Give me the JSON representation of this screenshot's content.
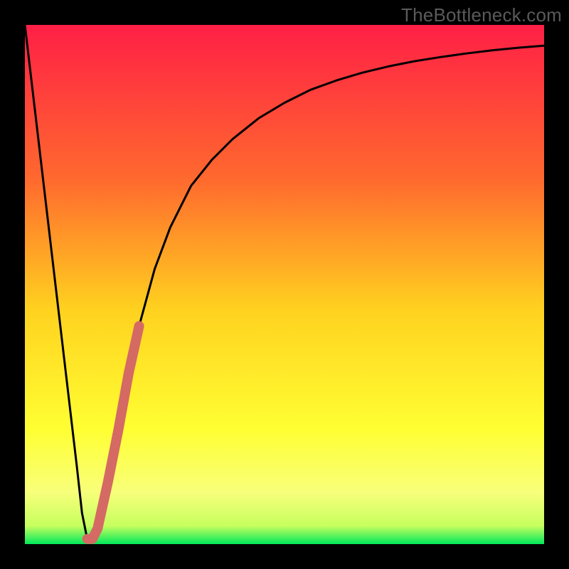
{
  "watermark": "TheBottleneck.com",
  "colors": {
    "frame": "#000000",
    "gradient_top": "#ff1f46",
    "gradient_mid1": "#ff6a2e",
    "gradient_mid2": "#ffd21f",
    "gradient_mid3": "#ffff33",
    "gradient_bottom_band": "#f8ff7a",
    "gradient_bottom": "#00e85c",
    "curve_stroke": "#000000",
    "accent_stroke": "#d46a63"
  },
  "chart_data": {
    "type": "line",
    "title": "",
    "xlabel": "",
    "ylabel": "",
    "xlim": [
      0,
      100
    ],
    "ylim": [
      0,
      100
    ],
    "series": [
      {
        "name": "bottleneck-curve",
        "x": [
          0,
          2,
          4,
          6,
          8,
          10,
          11,
          12,
          13,
          14,
          16,
          18,
          20,
          22,
          25,
          28,
          32,
          36,
          40,
          45,
          50,
          55,
          60,
          65,
          70,
          75,
          80,
          85,
          90,
          95,
          100
        ],
        "y": [
          100,
          83,
          66,
          49,
          32,
          15,
          6,
          1,
          1,
          3,
          12,
          22,
          33,
          42,
          53,
          61,
          69,
          74,
          78,
          82,
          85,
          87.5,
          89.3,
          90.8,
          92,
          93,
          93.8,
          94.5,
          95.1,
          95.6,
          96
        ]
      },
      {
        "name": "highlight-segment",
        "x": [
          12,
          13,
          14,
          16,
          18,
          20,
          22
        ],
        "y": [
          1,
          1,
          3,
          12,
          22,
          33,
          42
        ]
      }
    ],
    "gradient_stops": [
      {
        "pos": 0.0,
        "color": "#ff1f46"
      },
      {
        "pos": 0.3,
        "color": "#ff6a2e"
      },
      {
        "pos": 0.55,
        "color": "#ffd21f"
      },
      {
        "pos": 0.78,
        "color": "#ffff33"
      },
      {
        "pos": 0.9,
        "color": "#f8ff7a"
      },
      {
        "pos": 0.965,
        "color": "#c6ff5e"
      },
      {
        "pos": 1.0,
        "color": "#00e85c"
      }
    ]
  }
}
